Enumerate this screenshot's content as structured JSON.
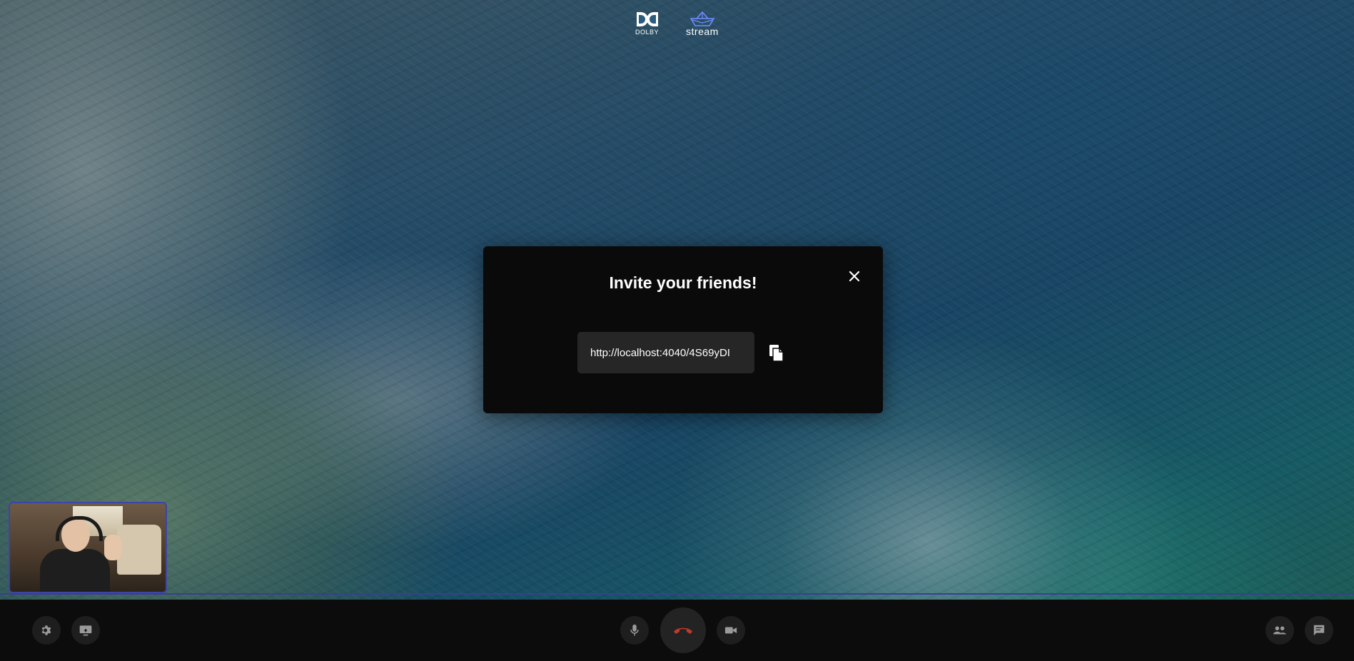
{
  "brand": {
    "dolby_label": "DOLBY",
    "stream_label": "stream"
  },
  "modal": {
    "title": "Invite your friends!",
    "invite_link": "http://localhost:4040/4S69yDI",
    "close_icon": "close-icon",
    "copy_icon": "copy-icon"
  },
  "controls": {
    "left": [
      "gear-icon",
      "screen-share-icon"
    ],
    "center": [
      "mic-icon",
      "hangup-icon",
      "camera-icon"
    ],
    "right": [
      "participants-icon",
      "chat-icon"
    ]
  },
  "colors": {
    "hangup": "#c0392b",
    "self_tile_border": "#3e44a8",
    "modal_bg": "#0a0a0a",
    "link_box_bg": "#262626",
    "control_bar_bg": "#0c0c0c",
    "control_button_bg": "#1e1e1e",
    "icon_color": "#9a9a9a"
  }
}
